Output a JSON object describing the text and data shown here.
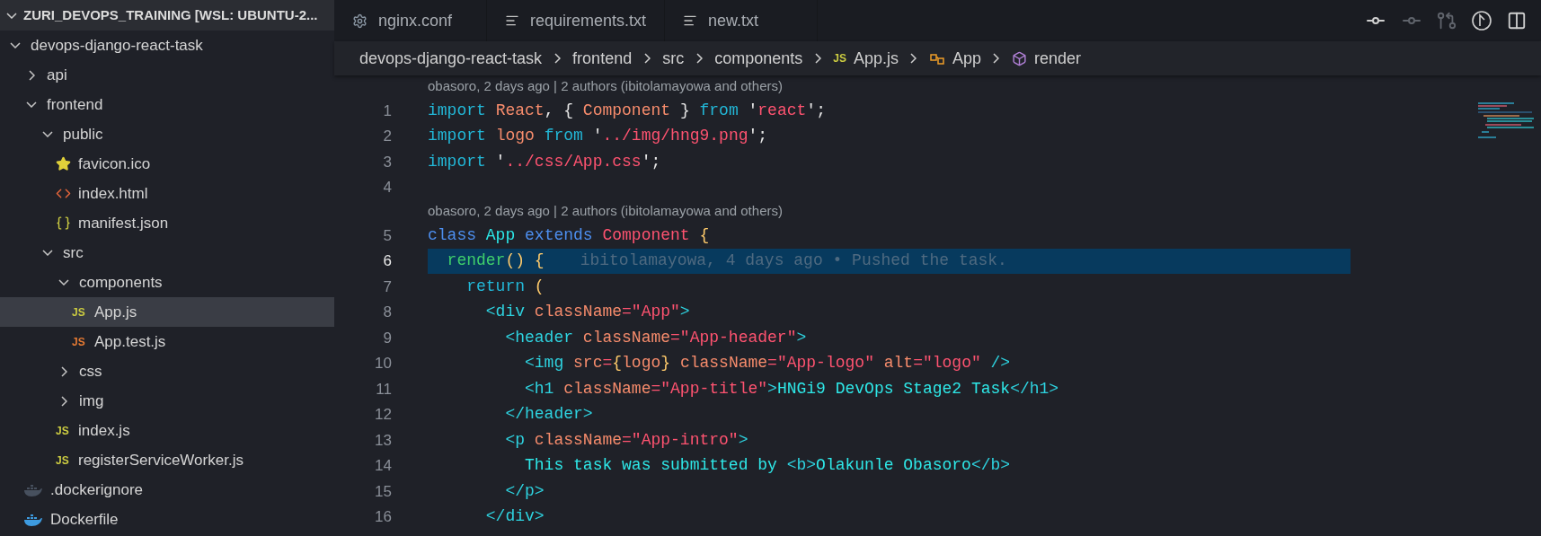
{
  "explorer": {
    "title": "ZURI_DEVOPS_TRAINING [WSL: UBUNTU-2...",
    "expanded": true,
    "tree": [
      {
        "label": "devops-django-react-task",
        "kind": "folder",
        "expanded": true,
        "selected": false,
        "children": [
          {
            "label": "api",
            "kind": "folder",
            "expanded": false,
            "selected": false
          },
          {
            "label": "frontend",
            "kind": "folder",
            "expanded": true,
            "selected": false,
            "children": [
              {
                "label": "public",
                "kind": "folder",
                "expanded": true,
                "selected": false,
                "children": [
                  {
                    "label": "favicon.ico",
                    "kind": "star",
                    "selected": false
                  },
                  {
                    "label": "index.html",
                    "kind": "html",
                    "selected": false
                  },
                  {
                    "label": "manifest.json",
                    "kind": "json",
                    "selected": false
                  }
                ]
              },
              {
                "label": "src",
                "kind": "folder",
                "expanded": true,
                "selected": false,
                "children": [
                  {
                    "label": "components",
                    "kind": "folder",
                    "expanded": true,
                    "selected": false,
                    "children": [
                      {
                        "label": "App.js",
                        "kind": "js",
                        "badge": "JS",
                        "selected": true
                      },
                      {
                        "label": "App.test.js",
                        "kind": "test",
                        "badge": "JS",
                        "selected": false
                      }
                    ]
                  },
                  {
                    "label": "css",
                    "kind": "folder",
                    "expanded": false,
                    "selected": false
                  },
                  {
                    "label": "img",
                    "kind": "folder",
                    "expanded": false,
                    "selected": false
                  },
                  {
                    "label": "index.js",
                    "kind": "js",
                    "badge": "JS",
                    "selected": false
                  },
                  {
                    "label": "registerServiceWorker.js",
                    "kind": "js",
                    "badge": "JS",
                    "selected": false
                  }
                ]
              }
            ]
          },
          {
            "label": ".dockerignore",
            "kind": "docker-dim",
            "selected": false
          },
          {
            "label": "Dockerfile",
            "kind": "docker",
            "selected": false
          }
        ]
      }
    ]
  },
  "tabs": [
    {
      "label": "nginx.conf",
      "kind": "gear",
      "selected": false
    },
    {
      "label": "requirements.txt",
      "kind": "lines",
      "selected": false
    },
    {
      "label": "new.txt",
      "kind": "lines",
      "selected": false
    }
  ],
  "breadcrumb": [
    {
      "label": "devops-django-react-task",
      "kind": "text"
    },
    {
      "label": "frontend",
      "kind": "text"
    },
    {
      "label": "src",
      "kind": "text"
    },
    {
      "label": "components",
      "kind": "text"
    },
    {
      "label": "App.js",
      "kind": "js",
      "badge": "JS"
    },
    {
      "label": "App",
      "kind": "class"
    },
    {
      "label": "render",
      "kind": "method"
    }
  ],
  "code": [
    {
      "number": "1",
      "blame_above": "obasoro, 2 days ago | 2 authors (ibitolamayowa and others)",
      "current": false,
      "tokens": [
        {
          "text": "import ",
          "kind": "kw"
        },
        {
          "text": "React",
          "kind": "var"
        },
        {
          "text": ", { ",
          "kind": "plain"
        },
        {
          "text": "Component",
          "kind": "var"
        },
        {
          "text": " } ",
          "kind": "plain"
        },
        {
          "text": "from",
          "kind": "kw"
        },
        {
          "text": " '",
          "kind": "plain"
        },
        {
          "text": "react",
          "kind": "str"
        },
        {
          "text": "';",
          "kind": "plain"
        }
      ]
    },
    {
      "number": "2",
      "current": false,
      "tokens": [
        {
          "text": "import ",
          "kind": "kw"
        },
        {
          "text": "logo ",
          "kind": "var"
        },
        {
          "text": "from",
          "kind": "kw"
        },
        {
          "text": " '",
          "kind": "plain"
        },
        {
          "text": "../img/hng9.png",
          "kind": "str"
        },
        {
          "text": "';",
          "kind": "plain"
        }
      ]
    },
    {
      "number": "3",
      "current": false,
      "tokens": [
        {
          "text": "import",
          "kind": "kw"
        },
        {
          "text": " '",
          "kind": "plain"
        },
        {
          "text": "../css/App.css",
          "kind": "str"
        },
        {
          "text": "';",
          "kind": "plain"
        }
      ]
    },
    {
      "number": "4",
      "current": false
    },
    {
      "number": "5",
      "blame_above": "obasoro, 2 days ago | 2 authors (ibitolamayowa and others)",
      "current": false,
      "tokens": [
        {
          "text": "class ",
          "kind": "decl"
        },
        {
          "text": "App ",
          "kind": "name"
        },
        {
          "text": "extends ",
          "kind": "decl"
        },
        {
          "text": "Component",
          "kind": "str"
        },
        {
          "text": " {",
          "kind": "brace"
        }
      ]
    },
    {
      "number": "6",
      "current": true,
      "blame_inline": "ibitolamayowa, 4 days ago • Pushed the task.",
      "tokens": [
        {
          "text": "  render",
          "kind": "func"
        },
        {
          "text": "() {",
          "kind": "brace"
        }
      ]
    },
    {
      "number": "7",
      "current": false,
      "tokens": [
        {
          "text": "    return",
          "kind": "kw"
        },
        {
          "text": " (",
          "kind": "brace"
        }
      ]
    },
    {
      "number": "8",
      "current": false,
      "tokens": [
        {
          "text": "      <div ",
          "kind": "tag"
        },
        {
          "text": "className",
          "kind": "attr"
        },
        {
          "text": "=\"App\"",
          "kind": "str"
        },
        {
          "text": ">",
          "kind": "tag"
        }
      ]
    },
    {
      "number": "9",
      "current": false,
      "tokens": [
        {
          "text": "        <header ",
          "kind": "tag"
        },
        {
          "text": "className",
          "kind": "attr"
        },
        {
          "text": "=\"App-header\"",
          "kind": "str"
        },
        {
          "text": ">",
          "kind": "tag"
        }
      ]
    },
    {
      "number": "10",
      "current": false,
      "tokens": [
        {
          "text": "          <img ",
          "kind": "tag"
        },
        {
          "text": "src",
          "kind": "attr"
        },
        {
          "text": "=",
          "kind": "str"
        },
        {
          "text": "{",
          "kind": "brace"
        },
        {
          "text": "logo",
          "kind": "var"
        },
        {
          "text": "} ",
          "kind": "brace"
        },
        {
          "text": "className",
          "kind": "attr"
        },
        {
          "text": "=\"App-logo\" ",
          "kind": "str"
        },
        {
          "text": "alt",
          "kind": "attr"
        },
        {
          "text": "=\"logo\"",
          "kind": "str"
        },
        {
          "text": " />",
          "kind": "tag"
        }
      ]
    },
    {
      "number": "11",
      "current": false,
      "tokens": [
        {
          "text": "          <h1 ",
          "kind": "tag"
        },
        {
          "text": "className",
          "kind": "attr"
        },
        {
          "text": "=\"App-title\"",
          "kind": "str"
        },
        {
          "text": ">",
          "kind": "tag"
        },
        {
          "text": "HNGi9 DevOps Stage2 Task",
          "kind": "text"
        },
        {
          "text": "</h1>",
          "kind": "tag"
        }
      ]
    },
    {
      "number": "12",
      "current": false,
      "tokens": [
        {
          "text": "        </header>",
          "kind": "tag"
        }
      ]
    },
    {
      "number": "13",
      "current": false,
      "tokens": [
        {
          "text": "        <p ",
          "kind": "tag"
        },
        {
          "text": "className",
          "kind": "attr"
        },
        {
          "text": "=\"App-intro\"",
          "kind": "str"
        },
        {
          "text": ">",
          "kind": "tag"
        }
      ]
    },
    {
      "number": "14",
      "current": false,
      "tokens": [
        {
          "text": "          This task was submitted by ",
          "kind": "text"
        },
        {
          "text": "<b>",
          "kind": "tag"
        },
        {
          "text": "Olakunle Obasoro",
          "kind": "text"
        },
        {
          "text": "</b>",
          "kind": "tag"
        }
      ]
    },
    {
      "number": "15",
      "current": false,
      "tokens": [
        {
          "text": "        </p>",
          "kind": "tag"
        }
      ]
    },
    {
      "number": "16",
      "current": false,
      "tokens": [
        {
          "text": "      </div>",
          "kind": "tag"
        }
      ]
    }
  ]
}
